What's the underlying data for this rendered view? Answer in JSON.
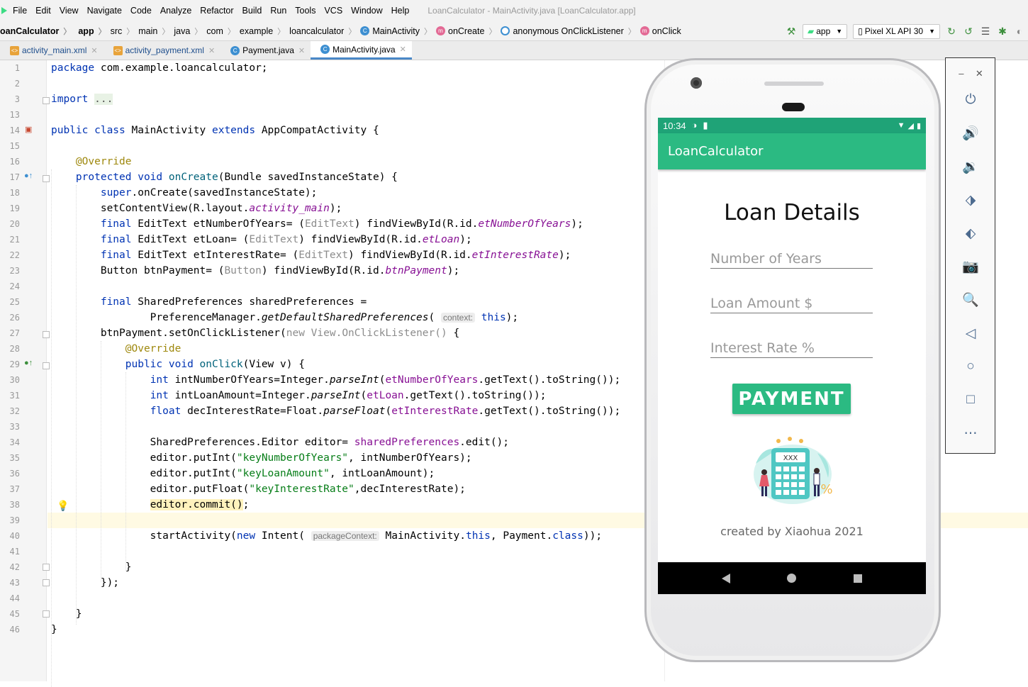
{
  "menubar": {
    "items": [
      "File",
      "Edit",
      "View",
      "Navigate",
      "Code",
      "Analyze",
      "Refactor",
      "Build",
      "Run",
      "Tools",
      "VCS",
      "Window",
      "Help"
    ],
    "window_title": "LoanCalculator - MainActivity.java [LoanCalculator.app]"
  },
  "navbar": {
    "crumbs": [
      "oanCalculator",
      "app",
      "src",
      "main",
      "java",
      "com",
      "example",
      "loancalculator",
      "MainActivity",
      "onCreate",
      "anonymous OnClickListener",
      "onClick"
    ],
    "run_config": "app",
    "device": "Pixel XL API 30"
  },
  "tabs": [
    "activity_main.xml",
    "activity_payment.xml",
    "Payment.java",
    "MainActivity.java"
  ],
  "editor": {
    "line_numbers": [
      "1",
      "2",
      "3",
      "13",
      "14",
      "15",
      "16",
      "17",
      "18",
      "19",
      "20",
      "21",
      "22",
      "23",
      "24",
      "25",
      "26",
      "27",
      "28",
      "29",
      "30",
      "31",
      "32",
      "33",
      "34",
      "35",
      "36",
      "37",
      "38",
      "39",
      "40",
      "41",
      "42",
      "43",
      "44",
      "45",
      "46"
    ]
  },
  "phone": {
    "time": "10:34",
    "app_title": "LoanCalculator",
    "heading": "Loan Details",
    "fields": {
      "years_placeholder": "Number of Years",
      "amount_placeholder": "Loan Amount $",
      "rate_placeholder": "Interest Rate %"
    },
    "button": "PAYMENT",
    "credit": "created by Xiaohua 2021",
    "illustration_label": "XXX"
  },
  "colors": {
    "accent": "#2bba82",
    "status_bar": "#1fa377",
    "keyword": "#0033b3",
    "function": "#00627a",
    "string": "#067d17",
    "field": "#871094",
    "annotation": "#9e880d"
  }
}
